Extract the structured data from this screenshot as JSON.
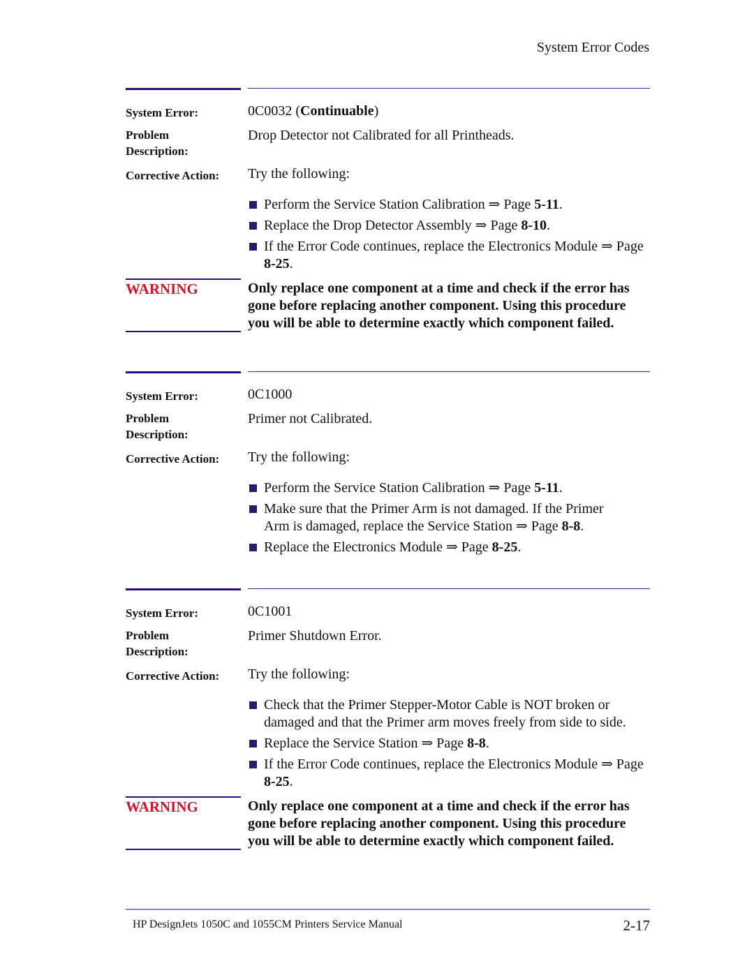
{
  "header": {
    "running_head": "System Error Codes"
  },
  "labels": {
    "system_error": "System Error:",
    "problem_line1": "Problem",
    "problem_line2": "Description:",
    "corrective_action": "Corrective Action:",
    "warning": "WARNING"
  },
  "colors": {
    "rule": "#2a0a7e",
    "warning": "#d4122a",
    "bullet": "#2a1a6e",
    "footer_rule": "#9a7cc8"
  },
  "errors": [
    {
      "code": "0C0032",
      "code_suffix_open": " (",
      "code_qualifier": "Continuable",
      "code_suffix_close": ")",
      "problem": "Drop Detector not Calibrated for all Printheads.",
      "action_intro": "Try the following:",
      "actions": [
        {
          "text": "Perform the Service Station Calibration ⇒ Page ",
          "page": "5-11",
          "end": "."
        },
        {
          "text": "Replace the Drop Detector Assembly ⇒ Page ",
          "page": "8-10",
          "end": "."
        },
        {
          "text": "If the Error Code continues, replace the Electronics Module ⇒ Page ",
          "page": "8-25",
          "end": "."
        }
      ],
      "warning": "Only replace one component at a time and check if the error has gone before replacing another component. Using this procedure you will be able to determine exactly which component failed."
    },
    {
      "code": "0C1000",
      "problem": "Primer not Calibrated.",
      "action_intro": "Try the following:",
      "actions": [
        {
          "text": "Perform the Service Station Calibration ⇒ Page ",
          "page": "5-11",
          "end": "."
        },
        {
          "text": "Make sure that the Primer Arm is not damaged. If the Primer Arm is damaged, replace the Service Station ⇒ Page ",
          "page": "8-8",
          "end": "."
        },
        {
          "text": "Replace the Electronics Module ⇒ Page ",
          "page": "8-25",
          "end": "."
        }
      ]
    },
    {
      "code": "0C1001",
      "problem": "Primer Shutdown Error.",
      "action_intro": "Try the following:",
      "actions": [
        {
          "text": "Check that the Primer Stepper-Motor Cable is NOT broken or damaged and that the Primer arm moves freely from side to side.",
          "page": "",
          "end": ""
        },
        {
          "text": "Replace the Service Station ⇒ Page ",
          "page": "8-8",
          "end": "."
        },
        {
          "text": "If the Error Code continues, replace the Electronics Module ⇒ Page ",
          "page": "8-25",
          "end": "."
        }
      ],
      "warning": "Only replace one component at a time and check if the error has gone before replacing another component. Using this procedure you will be able to determine exactly which component failed."
    }
  ],
  "footer": {
    "title": "HP DesignJets 1050C and 1055CM Printers Service Manual",
    "page_number": "2-17"
  }
}
